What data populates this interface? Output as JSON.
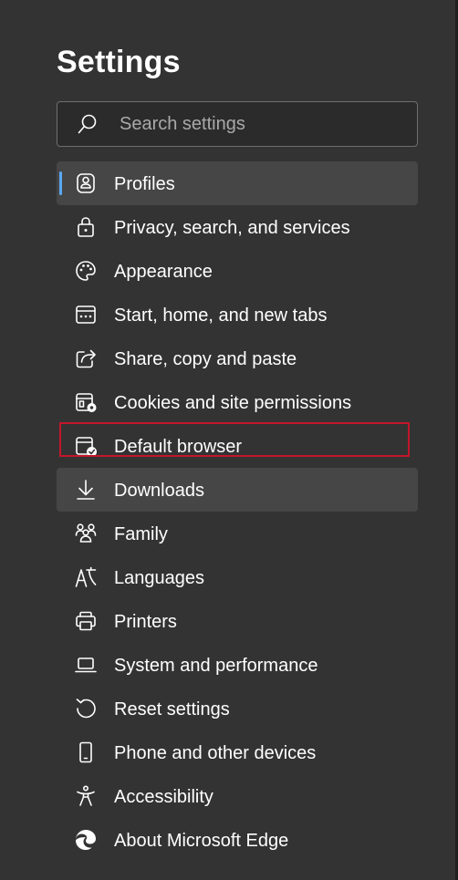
{
  "page": {
    "title": "Settings"
  },
  "search": {
    "placeholder": "Search settings",
    "value": "",
    "icon": "search-icon"
  },
  "accent_color": "#5aa9f5",
  "highlight_color": "#c4162a",
  "nav": {
    "active_item": "Profiles",
    "hover_item": "Downloads",
    "highlighted_item": "Default browser",
    "items": [
      {
        "label": "Profiles",
        "icon": "profile-icon"
      },
      {
        "label": "Privacy, search, and services",
        "icon": "lock-icon"
      },
      {
        "label": "Appearance",
        "icon": "palette-icon"
      },
      {
        "label": "Start, home, and new tabs",
        "icon": "start-page-icon"
      },
      {
        "label": "Share, copy and paste",
        "icon": "share-icon"
      },
      {
        "label": "Cookies and site permissions",
        "icon": "cookies-permissions-icon"
      },
      {
        "label": "Default browser",
        "icon": "default-browser-icon"
      },
      {
        "label": "Downloads",
        "icon": "download-icon"
      },
      {
        "label": "Family",
        "icon": "family-icon"
      },
      {
        "label": "Languages",
        "icon": "languages-icon"
      },
      {
        "label": "Printers",
        "icon": "printer-icon"
      },
      {
        "label": "System and performance",
        "icon": "laptop-icon"
      },
      {
        "label": "Reset settings",
        "icon": "reset-icon"
      },
      {
        "label": "Phone and other devices",
        "icon": "phone-icon"
      },
      {
        "label": "Accessibility",
        "icon": "accessibility-icon"
      },
      {
        "label": "About Microsoft Edge",
        "icon": "edge-logo-icon"
      }
    ]
  }
}
